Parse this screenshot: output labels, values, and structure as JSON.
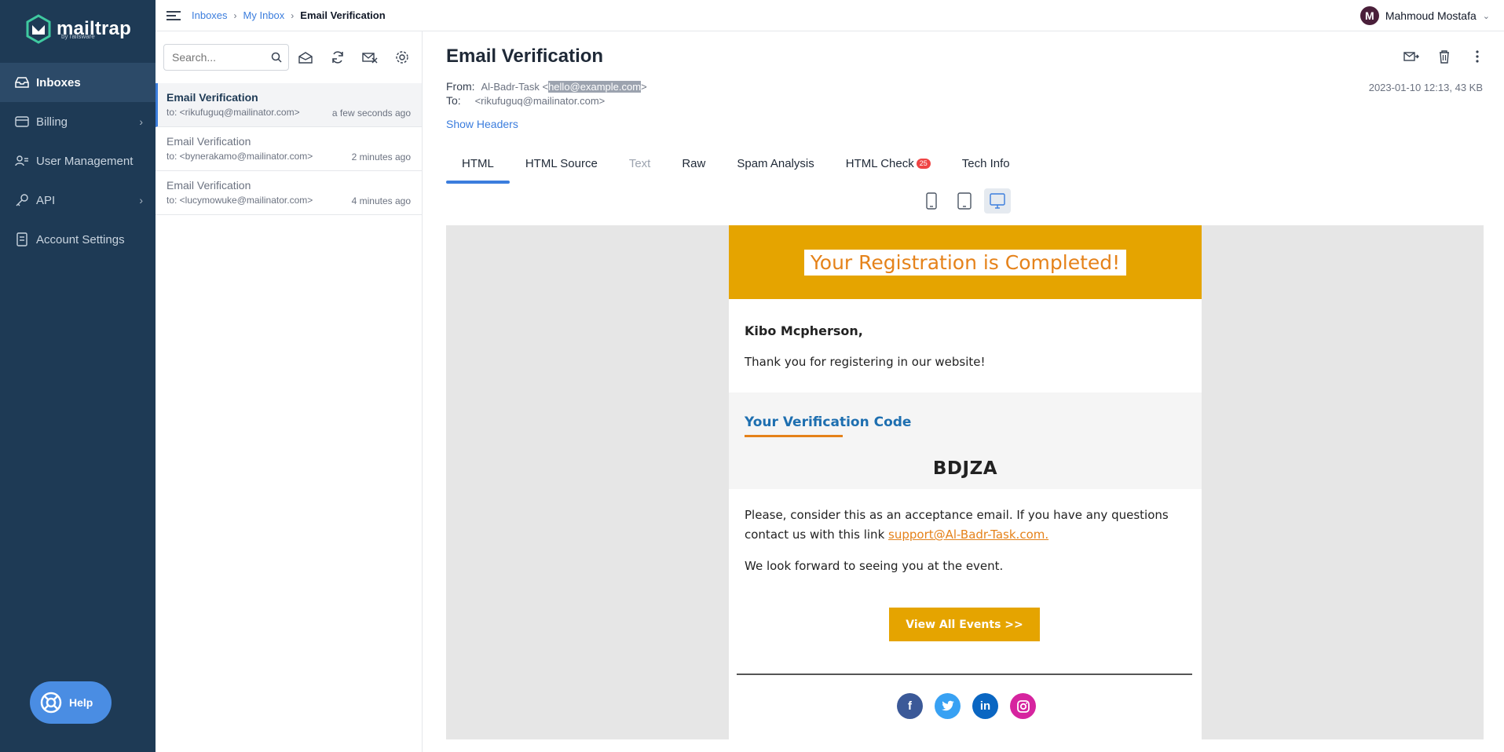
{
  "app": {
    "logo_text": "mailtrap",
    "logo_sub": "by railsware"
  },
  "sidebar": {
    "items": [
      {
        "label": "Inboxes",
        "icon": "inbox-icon",
        "active": true
      },
      {
        "label": "Billing",
        "icon": "billing-icon",
        "has_children": true
      },
      {
        "label": "User Management",
        "icon": "users-icon"
      },
      {
        "label": "API",
        "icon": "key-icon",
        "has_children": true
      },
      {
        "label": "Account Settings",
        "icon": "settings-doc-icon"
      }
    ],
    "help_label": "Help"
  },
  "header": {
    "breadcrumbs": [
      "Inboxes",
      "My Inbox",
      "Email Verification"
    ],
    "user_initial": "M",
    "user_name": "Mahmoud Mostafa"
  },
  "list": {
    "search_placeholder": "Search...",
    "messages": [
      {
        "subject": "Email Verification",
        "to": "to: <rikufuguq@mailinator.com>",
        "time": "a few seconds ago",
        "active": true
      },
      {
        "subject": "Email Verification",
        "to": "to: <bynerakamo@mailinator.com>",
        "time": "2 minutes ago"
      },
      {
        "subject": "Email Verification",
        "to": "to: <lucymowuke@mailinator.com>",
        "time": "4 minutes ago"
      }
    ]
  },
  "message": {
    "title": "Email Verification",
    "from_label": "From:",
    "from_name": "Al-Badr-Task <",
    "from_email": "hello@example.com",
    "from_close": ">",
    "to_label": "To:",
    "to_value": "<rikufuguq@mailinator.com>",
    "meta": "2023-01-10 12:13, 43 KB",
    "show_headers": "Show Headers",
    "tabs": [
      {
        "label": "HTML",
        "active": true
      },
      {
        "label": "HTML Source"
      },
      {
        "label": "Text",
        "disabled": true
      },
      {
        "label": "Raw"
      },
      {
        "label": "Spam Analysis"
      },
      {
        "label": "HTML Check",
        "badge": "25"
      },
      {
        "label": "Tech Info"
      }
    ]
  },
  "email": {
    "banner_title": "Your Registration is Completed!",
    "greeting": "Kibo Mcpherson,",
    "thanks": "Thank you for registering in our website!",
    "code_title": "Your Verification Code",
    "code": "BDJZA",
    "para1_text": "Please, consider this as an acceptance email. If you have any questions contact us with this link ",
    "para1_link": "support@Al-Badr-Task.com.",
    "para2": "We look forward to seeing you at the event.",
    "cta": "View All Events >>",
    "socials": [
      "facebook-icon",
      "twitter-icon",
      "linkedin-icon",
      "instagram-icon"
    ]
  },
  "colors": {
    "sidebar_bg": "#1e3a55",
    "accent": "#3b7ddd",
    "banner": "#e5a400",
    "orange_text": "#e5821a",
    "badge": "#ef4444"
  }
}
